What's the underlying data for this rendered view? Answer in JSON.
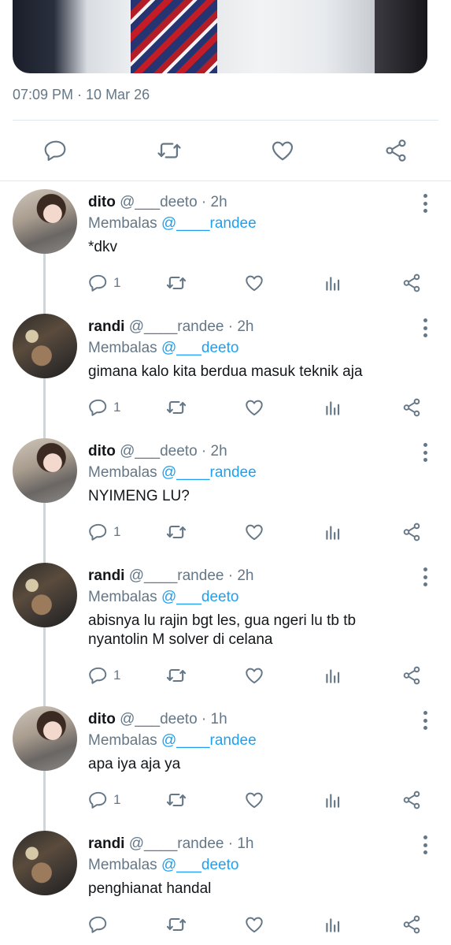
{
  "tweet": {
    "timestamp": "07:09 PM · 10 Mar 26",
    "actions": [
      {
        "name": "reply-icon"
      },
      {
        "name": "retweet-icon"
      },
      {
        "name": "like-icon"
      },
      {
        "name": "share-icon"
      }
    ]
  },
  "labels": {
    "replying_prefix": "Membalas"
  },
  "replies": [
    {
      "name": "dito",
      "handle": "@___deeto",
      "time": "2h",
      "replying_to": "@____randee",
      "text": "*dkv",
      "reply_count": "1",
      "avatar": "dito"
    },
    {
      "name": "randi",
      "handle": "@____randee",
      "time": "2h",
      "replying_to": "@___deeto",
      "text": "gimana kalo kita berdua masuk teknik aja",
      "reply_count": "1",
      "avatar": "randi"
    },
    {
      "name": "dito",
      "handle": "@___deeto",
      "time": "2h",
      "replying_to": "@____randee",
      "text": "NYIMENG LU?",
      "reply_count": "1",
      "avatar": "dito"
    },
    {
      "name": "randi",
      "handle": "@____randee",
      "time": "2h",
      "replying_to": "@___deeto",
      "text": "abisnya lu rajin bgt les, gua ngeri lu tb tb nyantolin M solver di celana",
      "reply_count": "1",
      "avatar": "randi"
    },
    {
      "name": "dito",
      "handle": "@___deeto",
      "time": "1h",
      "replying_to": "@____randee",
      "text": "apa iya aja ya",
      "reply_count": "1",
      "avatar": "dito"
    },
    {
      "name": "randi",
      "handle": "@____randee",
      "time": "1h",
      "replying_to": "@___deeto",
      "text": "penghianat handal",
      "reply_count": "",
      "avatar": "randi"
    }
  ],
  "colors": {
    "accent": "#1da1f2",
    "muted": "#657786",
    "icon": "#657786",
    "border": "#e1e8ed"
  }
}
